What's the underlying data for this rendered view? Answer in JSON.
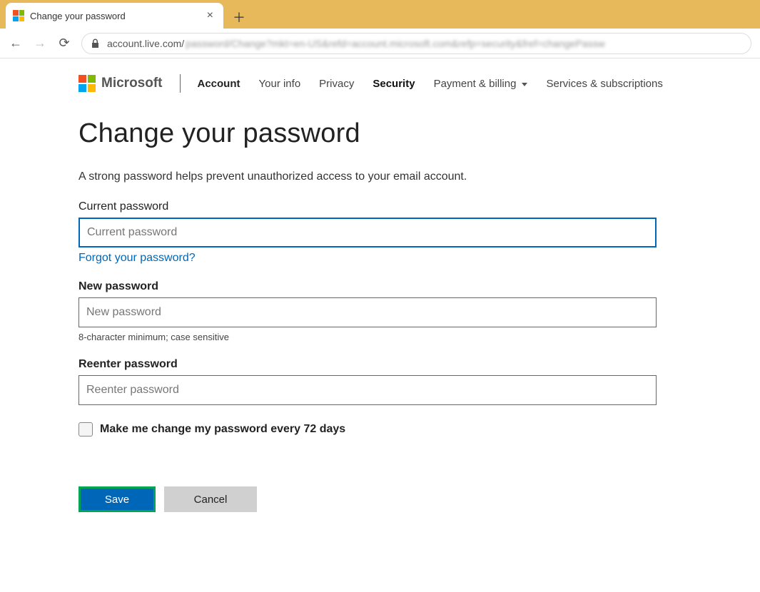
{
  "browser": {
    "tab_title": "Change your password",
    "url_visible": "account.live.com/",
    "url_blurred": "password/Change?mkt=en-US&refd=account.microsoft.com&refp=security&fref=changePassw"
  },
  "header": {
    "brand": "Microsoft",
    "nav": {
      "account": "Account",
      "your_info": "Your info",
      "privacy": "Privacy",
      "security": "Security",
      "payment": "Payment & billing",
      "services": "Services & subscriptions"
    }
  },
  "main": {
    "title": "Change your password",
    "subtitle": "A strong password helps prevent unauthorized access to your email account.",
    "current": {
      "label": "Current password",
      "placeholder": "Current password",
      "forgot": "Forgot your password?"
    },
    "new": {
      "label": "New password",
      "placeholder": "New password",
      "hint": "8-character minimum; case sensitive"
    },
    "reenter": {
      "label": "Reenter password",
      "placeholder": "Reenter password"
    },
    "checkbox_label": "Make me change my password every 72 days",
    "buttons": {
      "save": "Save",
      "cancel": "Cancel"
    }
  }
}
